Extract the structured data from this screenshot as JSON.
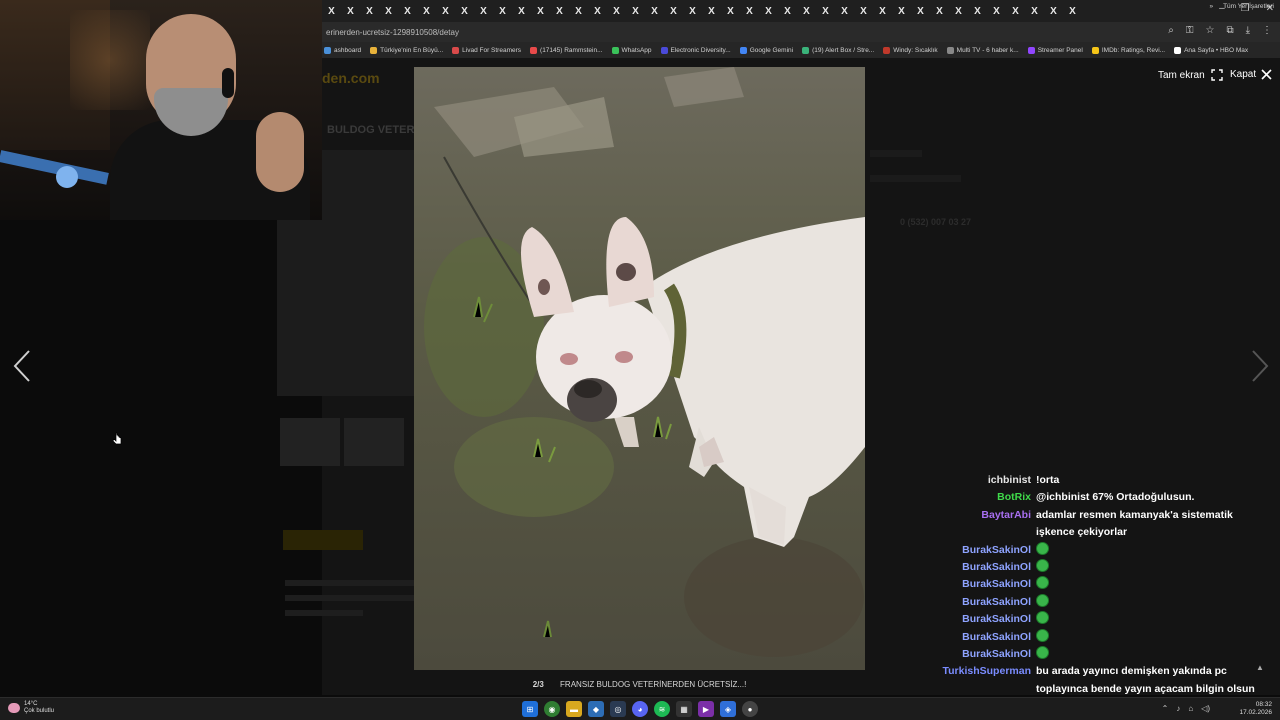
{
  "browser": {
    "tab_glyph": "X",
    "tab_count": 40,
    "url": "erinerden-ucretsiz-1298910508/detay",
    "bookmarks": [
      "ashboard",
      "Türkiye'nin En Büyü...",
      "Livad For Streamers",
      "(17145) Rammstein...",
      "WhatsApp",
      "Electronic Diversity...",
      "Google Gemini",
      "(19) Alert Box / Stre...",
      "Windy: Sıcaklık",
      "Multi TV - 6 haber k...",
      "Streamer Panel",
      "IMDb: Ratings, Revi...",
      "Ana Sayfa • HBO Max"
    ],
    "bookmarks_more": "»",
    "all_bookmarks": "Tüm Yer İşaretleri"
  },
  "page": {
    "logo": "den.com",
    "title": "BULDOG VETER",
    "phone": "0 (532) 007 03 27"
  },
  "viewer": {
    "fullscreen_label": "Tam ekran",
    "close_label": "Kapat",
    "counter": "2/3",
    "caption": "FRANSIZ BULDOG VETERİNERDEN ÜCRETSİZ...!"
  },
  "chat": [
    {
      "user": "ichbinist",
      "color": "#e6e6e6",
      "message": "!orta",
      "emoji": false
    },
    {
      "user": "BotRix",
      "color": "#3fd94a",
      "message": "@ichbinist 67% Ortadoğulusun.",
      "emoji": false
    },
    {
      "user": "BaytarAbi",
      "color": "#a86ff0",
      "message": "adamlar resmen kamanyak'a sistematik işkence çekiyorlar",
      "emoji": false
    },
    {
      "user": "BurakSakinOl",
      "color": "#8ea3ff",
      "message": "",
      "emoji": true
    },
    {
      "user": "BurakSakinOl",
      "color": "#8ea3ff",
      "message": "",
      "emoji": true
    },
    {
      "user": "BurakSakinOl",
      "color": "#8ea3ff",
      "message": "",
      "emoji": true
    },
    {
      "user": "BurakSakinOl",
      "color": "#8ea3ff",
      "message": "",
      "emoji": true
    },
    {
      "user": "BurakSakinOl",
      "color": "#8ea3ff",
      "message": "",
      "emoji": true
    },
    {
      "user": "BurakSakinOl",
      "color": "#8ea3ff",
      "message": "",
      "emoji": true
    },
    {
      "user": "BurakSakinOl",
      "color": "#8ea3ff",
      "message": "",
      "emoji": true
    },
    {
      "user": "TurkishSuperman",
      "color": "#7a8cff",
      "message": "bu arada yayıncı demişken yakında pc toplayınca bende yayın açacam bilgin olsun abim :)",
      "emoji": false
    }
  ],
  "taskbar": {
    "temperature": "14°C",
    "weather": "Çok bulutlu",
    "time": "08:32",
    "date": "17.02.2026"
  }
}
